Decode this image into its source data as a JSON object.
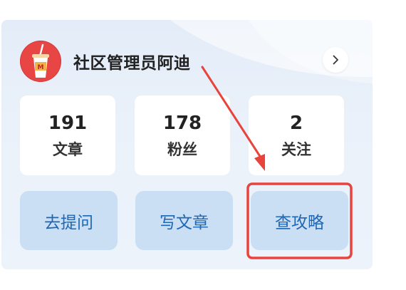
{
  "profile": {
    "username": "社区管理员阿迪"
  },
  "stats": [
    {
      "value": "191",
      "label": "文章"
    },
    {
      "value": "178",
      "label": "粉丝"
    },
    {
      "value": "2",
      "label": "关注"
    }
  ],
  "actions": [
    {
      "label": "去提问"
    },
    {
      "label": "写文章"
    },
    {
      "label": "查攻略"
    }
  ],
  "icons": {
    "avatar": "avatar-cup-icon",
    "more": "chevron-right-icon",
    "annotation_arrow": "arrow-icon"
  },
  "colors": {
    "card_bg": "#e6eef9",
    "action_bg": "#cadff3",
    "action_text": "#1f66b4",
    "annotation_red": "#e8433c",
    "avatar_red": "#e84545"
  }
}
